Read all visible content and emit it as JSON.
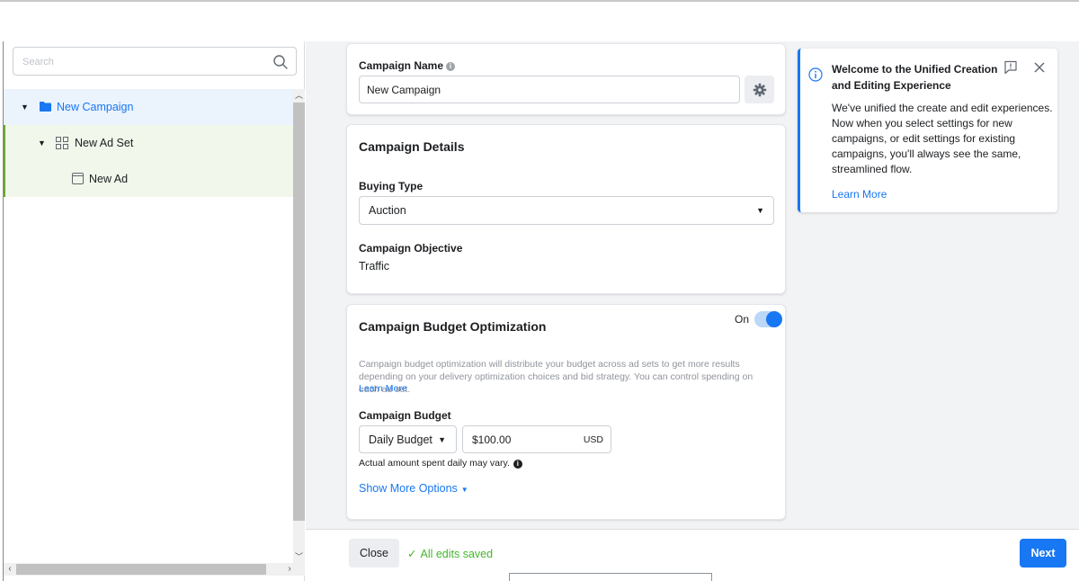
{
  "sidebar": {
    "search": {
      "placeholder": "Search",
      "value": ""
    },
    "tree": [
      {
        "label": "New Campaign",
        "level": "campaign"
      },
      {
        "label": "New Ad Set",
        "level": "adset"
      },
      {
        "label": "New Ad",
        "level": "ad"
      }
    ]
  },
  "campaign_name": {
    "label": "Campaign Name",
    "value": "New Campaign"
  },
  "campaign_details": {
    "title": "Campaign Details",
    "buying_type_label": "Buying Type",
    "buying_type_value": "Auction",
    "objective_label": "Campaign Objective",
    "objective_value": "Traffic"
  },
  "budget_optimization": {
    "title": "Campaign Budget Optimization",
    "toggle_label": "On",
    "toggle_on": true,
    "description": "Campaign budget optimization will distribute your budget across ad sets to get more results depending on your delivery optimization choices and bid strategy. You can control spending on each ad set.",
    "learn_more": "Learn More",
    "budget_label": "Campaign Budget",
    "budget_type": "Daily Budget",
    "budget_amount": "$100.00",
    "currency": "USD",
    "note": "Actual amount spent daily may vary.",
    "show_more": "Show More Options"
  },
  "welcome": {
    "title": "Welcome to the Unified Creation and Editing Experience",
    "body": "We've unified the create and edit experiences. Now when you select settings for new campaigns, or edit settings for existing campaigns, you'll always see the same, streamlined flow.",
    "learn_more": "Learn More"
  },
  "footer": {
    "close_label": "Close",
    "saved_status": "All edits saved",
    "next_label": "Next"
  },
  "colors": {
    "accent": "#1877f2",
    "success": "#42b72a",
    "campaign_row_bg": "#ebf3fd",
    "adset_row_bg": "#f1f7ea"
  }
}
